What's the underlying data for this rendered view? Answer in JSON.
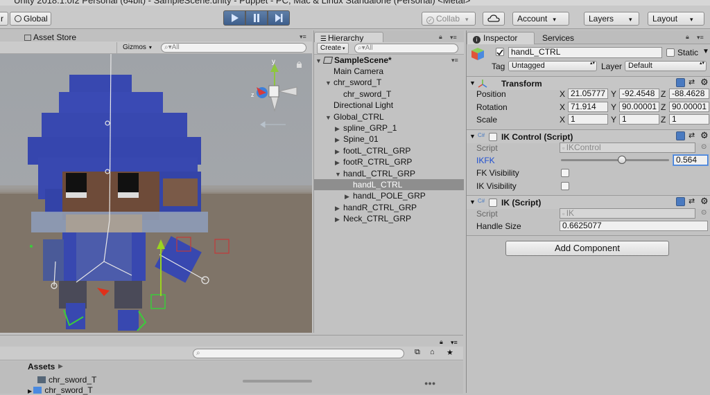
{
  "window_title": "Unity 2018.1.0f2 Personal (64bit) - SampleScene.unity - Puppet - PC, Mac & Linux Standalone (Personal) <Metal>",
  "toolbar": {
    "pivot_fragment": "r",
    "global_label": "Global",
    "collab_label": "Collab",
    "account_label": "Account",
    "layers_label": "Layers",
    "layout_label": "Layout"
  },
  "scene": {
    "tab_label": "Asset Store",
    "gizmos_label": "Gizmos",
    "search_placeholder": "All",
    "gizmo_axes": {
      "y": "y",
      "z": "z"
    }
  },
  "hierarchy": {
    "tab_label": "Hierarchy",
    "create_label": "Create",
    "search_placeholder": "All",
    "scene_name": "SampleScene*",
    "items": [
      {
        "label": "Main Camera",
        "indent": 1,
        "arrow": ""
      },
      {
        "label": "chr_sword_T",
        "indent": 1,
        "arrow": "down"
      },
      {
        "label": "chr_sword_T",
        "indent": 2,
        "arrow": ""
      },
      {
        "label": "Directional Light",
        "indent": 1,
        "arrow": ""
      },
      {
        "label": "Global_CTRL",
        "indent": 1,
        "arrow": "down"
      },
      {
        "label": "spline_GRP_1",
        "indent": 2,
        "arrow": "right"
      },
      {
        "label": "Spine_01",
        "indent": 2,
        "arrow": "right"
      },
      {
        "label": "footL_CTRL_GRP",
        "indent": 2,
        "arrow": "right"
      },
      {
        "label": "footR_CTRL_GRP",
        "indent": 2,
        "arrow": "right"
      },
      {
        "label": "handL_CTRL_GRP",
        "indent": 2,
        "arrow": "down"
      },
      {
        "label": "handL_CTRL",
        "indent": 3,
        "arrow": "",
        "selected": true
      },
      {
        "label": "handL_POLE_GRP",
        "indent": 3,
        "arrow": "right"
      },
      {
        "label": "handR_CTRL_GRP",
        "indent": 2,
        "arrow": "right"
      },
      {
        "label": "Neck_CTRL_GRP",
        "indent": 2,
        "arrow": "right"
      }
    ]
  },
  "inspector": {
    "tab_label": "Inspector",
    "services_tab_label": "Services",
    "object_name": "handL_CTRL",
    "static_label": "Static",
    "tag_label": "Tag",
    "tag_value": "Untagged",
    "layer_label": "Layer",
    "layer_value": "Default",
    "transform": {
      "title": "Transform",
      "position_label": "Position",
      "rotation_label": "Rotation",
      "scale_label": "Scale",
      "x_label": "X",
      "y_label": "Y",
      "z_label": "Z",
      "position": {
        "x": "21.05777",
        "y": "-92.4548",
        "z": "-88.4628"
      },
      "rotation": {
        "x": "71.914",
        "y": "90.00001",
        "z": "90.00001"
      },
      "scale": {
        "x": "1",
        "y": "1",
        "z": "1"
      }
    },
    "ik_control": {
      "title": "IK Control (Script)",
      "script_label": "Script",
      "script_value": "IKControl",
      "ikfk_label": "IKFK",
      "ikfk_value": "0.564",
      "ikfk_fraction": 0.564,
      "fk_visibility_label": "FK Visibility",
      "ik_visibility_label": "IK Visibility"
    },
    "ik_script": {
      "title": "IK (Script)",
      "script_label": "Script",
      "script_value": "IK",
      "handle_size_label": "Handle Size",
      "handle_size_value": "0.6625077"
    },
    "add_component_label": "Add Component"
  },
  "project": {
    "assets_label": "Assets",
    "search_placeholder": "",
    "items": [
      {
        "label": "chr_sword_T"
      },
      {
        "label": "chr_sword_T"
      }
    ]
  },
  "colors": {
    "selection": "#8e8e8e",
    "play_blue": "#4a6d99",
    "link_blue": "#1f4fd1",
    "character_blue": "#3848b0"
  }
}
